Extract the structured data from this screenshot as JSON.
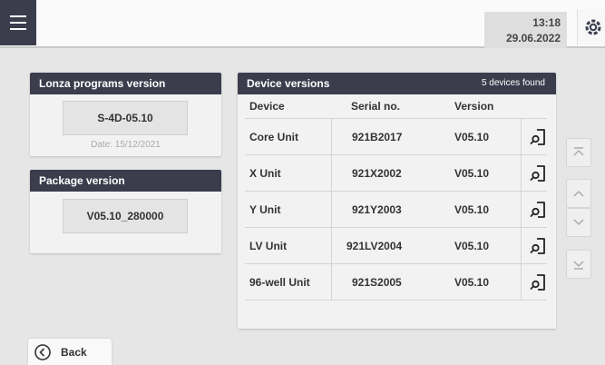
{
  "header": {
    "time": "13:18",
    "date": "29.06.2022"
  },
  "programs_panel": {
    "title": "Lonza programs version",
    "version": "S-4D-05.10",
    "date_label": "Date: 15/12/2021"
  },
  "package_panel": {
    "title": "Package version",
    "version": "V05.10_280000"
  },
  "devices_panel": {
    "title": "Device versions",
    "count_label": "5 devices found",
    "columns": [
      "Device",
      "Serial no.",
      "Version"
    ],
    "rows": [
      {
        "device": "Core Unit",
        "serial": "921B2017",
        "version": "V05.10"
      },
      {
        "device": "X Unit",
        "serial": "921X2002",
        "version": "V05.10"
      },
      {
        "device": "Y Unit",
        "serial": "921Y2003",
        "version": "V05.10"
      },
      {
        "device": "LV Unit",
        "serial": "921LV2004",
        "version": "V05.10"
      },
      {
        "device": "96-well Unit",
        "serial": "921S2005",
        "version": "V05.10"
      }
    ]
  },
  "footer": {
    "back_label": "Back"
  },
  "icons": {
    "menu": "menu-icon",
    "settings": "gear-icon",
    "row_action": "search-document-icon",
    "scroll_top": "chevron-top-icon",
    "scroll_up": "chevron-up-icon",
    "scroll_down": "chevron-down-icon",
    "scroll_bottom": "chevron-bottom-icon",
    "back": "circle-chevron-left-icon"
  },
  "colors": {
    "header_dark": "#3b3d4d",
    "background": "#e6e6e6"
  }
}
